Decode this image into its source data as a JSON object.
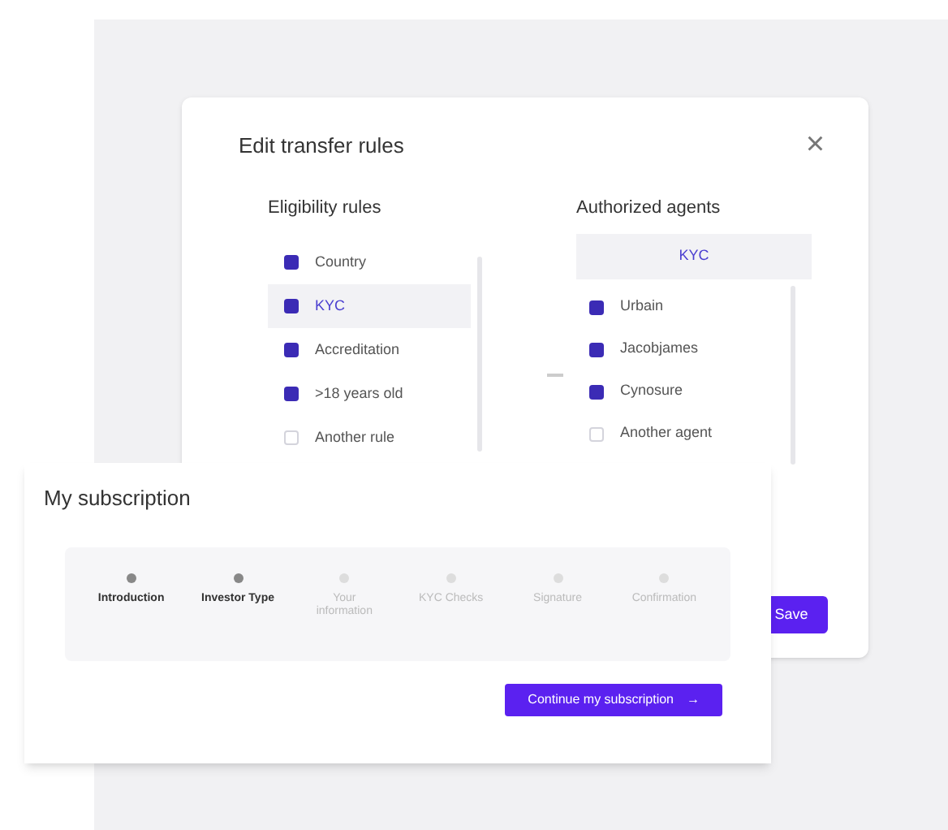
{
  "dialog": {
    "title": "Edit transfer rules",
    "close": "×",
    "save": "Save",
    "eligibility": {
      "heading": "Eligibility rules",
      "rules": [
        {
          "label": "Country",
          "checked": true,
          "selected": false
        },
        {
          "label": "KYC",
          "checked": true,
          "selected": true
        },
        {
          "label": "Accreditation",
          "checked": true,
          "selected": false
        },
        {
          "label": ">18 years old",
          "checked": true,
          "selected": false
        },
        {
          "label": "Another rule",
          "checked": false,
          "selected": false
        }
      ]
    },
    "agents": {
      "heading": "Authorized agents",
      "selected_rule": "KYC",
      "items": [
        {
          "label": "Urbain",
          "checked": true
        },
        {
          "label": "Jacobjames",
          "checked": true
        },
        {
          "label": "Cynosure",
          "checked": true
        },
        {
          "label": "Another agent",
          "checked": false
        }
      ]
    }
  },
  "subscription": {
    "title": "My subscription",
    "steps": [
      {
        "label": "Introduction",
        "done": true
      },
      {
        "label": "Investor Type",
        "done": true
      },
      {
        "label": "Your information",
        "done": false
      },
      {
        "label": "KYC Checks",
        "done": false
      },
      {
        "label": "Signature",
        "done": false
      },
      {
        "label": "Confirmation",
        "done": false
      }
    ],
    "continue": "Continue my subscription",
    "continue_arrow": "→"
  }
}
